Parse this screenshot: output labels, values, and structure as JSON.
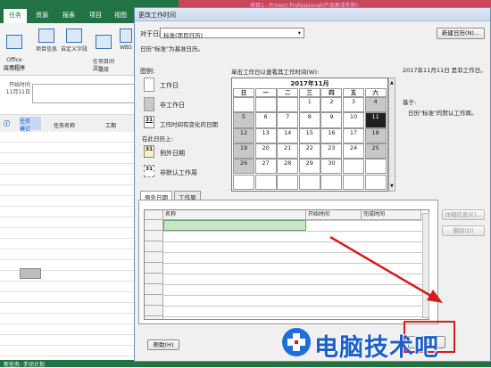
{
  "app": {
    "tabs": [
      "任务",
      "资源",
      "报表",
      "项目",
      "视图"
    ],
    "title": "项目1 - Project Professional(产品激活失败)",
    "ribbon": {
      "office_app_label": "Office\n应用程序",
      "project_info": "项目信息",
      "custom_fields": "自定义字段",
      "links_between_projects": "在项目间\n链接",
      "wbs": "WBS",
      "group_apps": "应用程序",
      "group_props": "属性"
    },
    "timeline_start_label": "开始时间\n11月11日",
    "grid_headers": {
      "mode": "任务\n模式",
      "name": "任务名称",
      "duration": "工期"
    },
    "status_bar": "新任务: 手动计划"
  },
  "dialog": {
    "title": "更改工作时间",
    "for_calendar_label": "对于日历(C):",
    "calendar_value": "标准(项目日历)",
    "base_calendar_note": "日历\"标准\"为基准日历。",
    "new_calendar_button": "新建日历(N)...",
    "legend_title": "图例:",
    "legend": {
      "working": "工作日",
      "nonworking": "非工作日",
      "edited_hours": "工作时间有变化的日期",
      "on_this_calendar": "在此日历上:",
      "exception_day": "例外日期",
      "nondefault_week": "非默认工作周",
      "sample_day": "31"
    },
    "calendar_instruction": "单击工作日以查看其工作时间(W):",
    "calendar": {
      "month_label": "2017年11月",
      "weekdays": [
        "日",
        "一",
        "二",
        "三",
        "四",
        "五",
        "六"
      ],
      "rows": [
        [
          "",
          "",
          "",
          "1",
          "2",
          "3",
          "4"
        ],
        [
          "5",
          "6",
          "7",
          "8",
          "9",
          "10",
          "11"
        ],
        [
          "12",
          "13",
          "14",
          "15",
          "16",
          "17",
          "18"
        ],
        [
          "19",
          "20",
          "21",
          "22",
          "23",
          "24",
          "25"
        ],
        [
          "26",
          "27",
          "28",
          "29",
          "30",
          "",
          ""
        ],
        [
          "",
          "",
          "",
          "",
          "",
          "",
          ""
        ]
      ],
      "selected_day": "11"
    },
    "selected_date_status": "2017年11月11日 是非工作日。",
    "based_on_label": "基于:",
    "based_on_detail": "日历\"标准\"的默认工作周。",
    "tabs": [
      "例外日期",
      "工作周"
    ],
    "table_headers": [
      "名称",
      "开始时间",
      "完成时间"
    ],
    "details_button": "详细信息(E)...",
    "delete_button": "删除(D)",
    "help_button": "帮助(H)",
    "ok_button": "确定"
  },
  "watermark": {
    "text": "电脑技术吧"
  },
  "colors": {
    "project_green": "#217346",
    "highlight_red": "#d21d1d",
    "selected_day": "#202020"
  }
}
